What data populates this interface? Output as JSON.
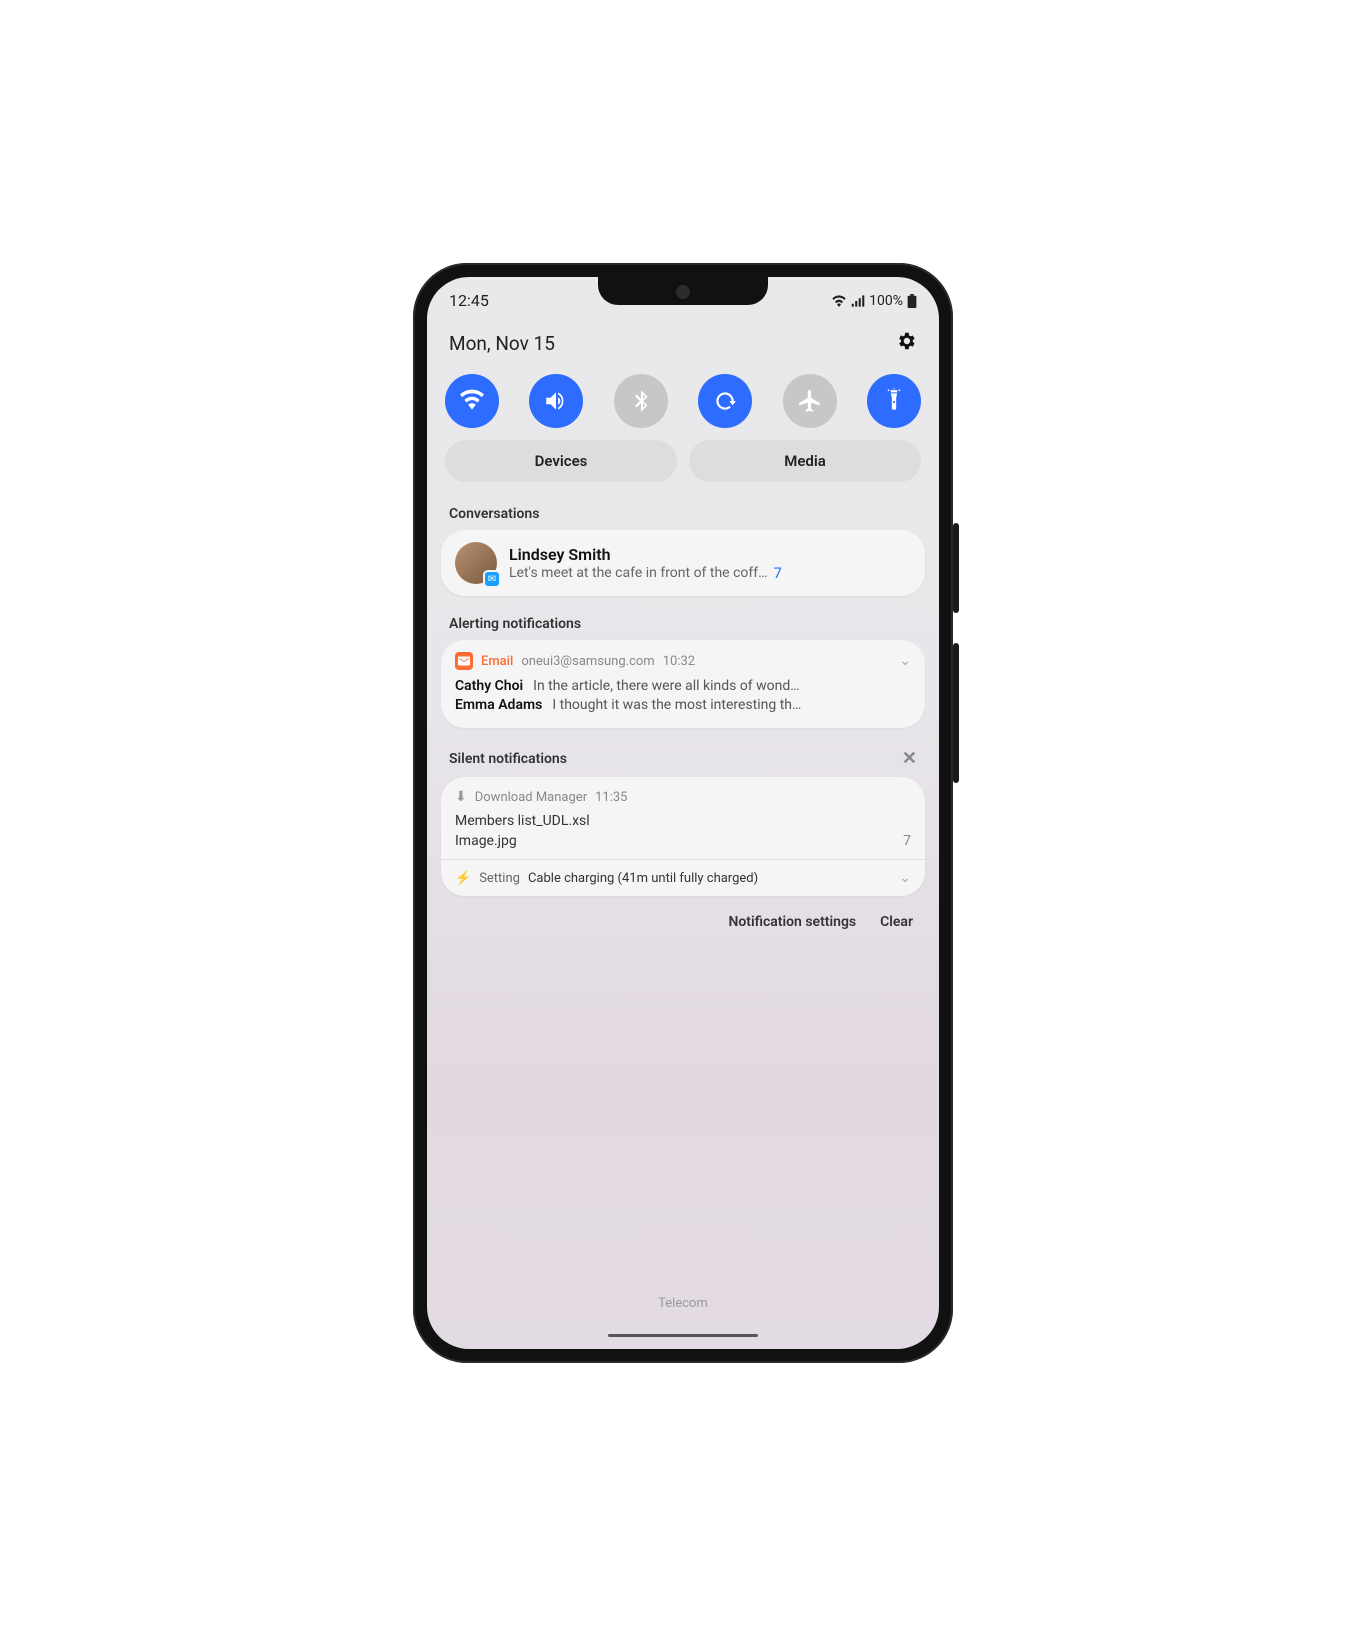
{
  "status": {
    "time": "12:45",
    "battery": "100%"
  },
  "date": "Mon, Nov 15",
  "quick_settings": [
    {
      "name": "wifi",
      "active": true
    },
    {
      "name": "sound",
      "active": true
    },
    {
      "name": "bluetooth",
      "active": false
    },
    {
      "name": "rotate",
      "active": true
    },
    {
      "name": "airplane",
      "active": false
    },
    {
      "name": "flashlight",
      "active": true
    }
  ],
  "pills": {
    "devices": "Devices",
    "media": "Media"
  },
  "sections": {
    "conversations": "Conversations",
    "alerting": "Alerting notifications",
    "silent": "Silent notifications"
  },
  "conversation": {
    "name": "Lindsey Smith",
    "message": "Let's meet at the cafe in front of the coff…",
    "count": "7"
  },
  "email": {
    "app": "Email",
    "from": "oneui3@samsung.com",
    "time": "10:32",
    "items": [
      {
        "sender": "Cathy Choi",
        "preview": "In the article, there were all kinds of wond…"
      },
      {
        "sender": "Emma Adams",
        "preview": "I thought it was the most interesting th…"
      }
    ]
  },
  "download": {
    "app": "Download Manager",
    "time": "11:35",
    "files": [
      {
        "name": "Members list_UDL.xsl",
        "count": ""
      },
      {
        "name": "Image.jpg",
        "count": "7"
      }
    ]
  },
  "setting": {
    "label": "Setting",
    "text": "Cable charging (41m until fully charged)"
  },
  "footer": {
    "settings": "Notification settings",
    "clear": "Clear"
  },
  "carrier": "Telecom"
}
